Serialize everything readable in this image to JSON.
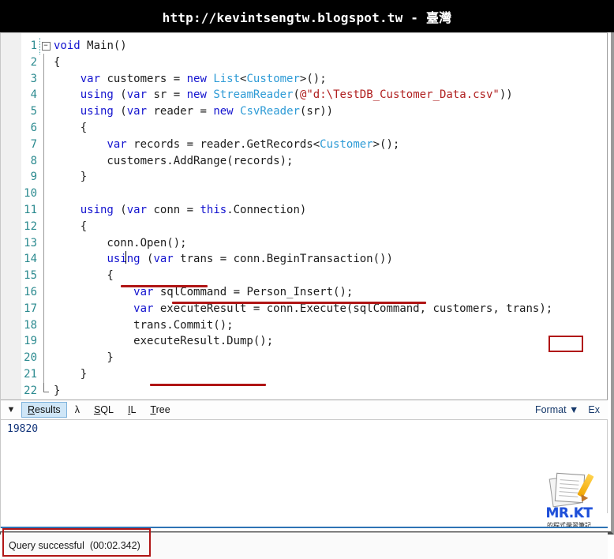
{
  "banner": {
    "title": "http://kevintsengtw.blogspot.tw - 臺灣"
  },
  "editor": {
    "lines": [
      {
        "no": "1",
        "segments": [
          {
            "t": "void ",
            "c": "kw"
          },
          {
            "t": "Main()",
            "c": "txt"
          }
        ]
      },
      {
        "no": "2",
        "segments": [
          {
            "t": "{",
            "c": "txt"
          }
        ]
      },
      {
        "no": "3",
        "segments": [
          {
            "t": "    ",
            "c": "txt"
          },
          {
            "t": "var",
            "c": "kw"
          },
          {
            "t": " customers = ",
            "c": "txt"
          },
          {
            "t": "new",
            "c": "kw"
          },
          {
            "t": " ",
            "c": "txt"
          },
          {
            "t": "List",
            "c": "typ"
          },
          {
            "t": "<",
            "c": "txt"
          },
          {
            "t": "Customer",
            "c": "typ"
          },
          {
            "t": ">();",
            "c": "txt"
          }
        ]
      },
      {
        "no": "4",
        "segments": [
          {
            "t": "    ",
            "c": "txt"
          },
          {
            "t": "using",
            "c": "kw"
          },
          {
            "t": " (",
            "c": "txt"
          },
          {
            "t": "var",
            "c": "kw"
          },
          {
            "t": " sr = ",
            "c": "txt"
          },
          {
            "t": "new",
            "c": "kw"
          },
          {
            "t": " ",
            "c": "txt"
          },
          {
            "t": "StreamReader",
            "c": "typ"
          },
          {
            "t": "(",
            "c": "txt"
          },
          {
            "t": "@\"d:\\TestDB_Customer_Data.csv\"",
            "c": "str"
          },
          {
            "t": "))",
            "c": "txt"
          }
        ]
      },
      {
        "no": "5",
        "segments": [
          {
            "t": "    ",
            "c": "txt"
          },
          {
            "t": "using",
            "c": "kw"
          },
          {
            "t": " (",
            "c": "txt"
          },
          {
            "t": "var",
            "c": "kw"
          },
          {
            "t": " reader = ",
            "c": "txt"
          },
          {
            "t": "new",
            "c": "kw"
          },
          {
            "t": " ",
            "c": "txt"
          },
          {
            "t": "CsvReader",
            "c": "typ"
          },
          {
            "t": "(sr))",
            "c": "txt"
          }
        ]
      },
      {
        "no": "6",
        "segments": [
          {
            "t": "    {",
            "c": "txt"
          }
        ]
      },
      {
        "no": "7",
        "segments": [
          {
            "t": "        ",
            "c": "txt"
          },
          {
            "t": "var",
            "c": "kw"
          },
          {
            "t": " records = reader.GetRecords<",
            "c": "txt"
          },
          {
            "t": "Customer",
            "c": "typ"
          },
          {
            "t": ">();",
            "c": "txt"
          }
        ]
      },
      {
        "no": "8",
        "segments": [
          {
            "t": "        customers.AddRange(records);",
            "c": "txt"
          }
        ]
      },
      {
        "no": "9",
        "segments": [
          {
            "t": "    }",
            "c": "txt"
          }
        ]
      },
      {
        "no": "10",
        "segments": [
          {
            "t": "",
            "c": "txt"
          }
        ]
      },
      {
        "no": "11",
        "segments": [
          {
            "t": "    ",
            "c": "txt"
          },
          {
            "t": "using",
            "c": "kw"
          },
          {
            "t": " (",
            "c": "txt"
          },
          {
            "t": "var",
            "c": "kw"
          },
          {
            "t": " conn = ",
            "c": "txt"
          },
          {
            "t": "this",
            "c": "kw"
          },
          {
            "t": ".Connection)",
            "c": "txt"
          }
        ]
      },
      {
        "no": "12",
        "segments": [
          {
            "t": "    {",
            "c": "txt"
          }
        ]
      },
      {
        "no": "13",
        "segments": [
          {
            "t": "        conn.Open();",
            "c": "txt"
          }
        ]
      },
      {
        "no": "14",
        "segments": [
          {
            "t": "        ",
            "c": "txt"
          },
          {
            "t": "using",
            "c": "kw"
          },
          {
            "t": " (",
            "c": "txt"
          },
          {
            "t": "var",
            "c": "kw"
          },
          {
            "t": " trans = conn.BeginTransaction())",
            "c": "txt"
          }
        ]
      },
      {
        "no": "15",
        "segments": [
          {
            "t": "        {",
            "c": "txt"
          }
        ]
      },
      {
        "no": "16",
        "segments": [
          {
            "t": "            ",
            "c": "txt"
          },
          {
            "t": "var",
            "c": "kw"
          },
          {
            "t": " sqlCommand = Person_Insert();",
            "c": "txt"
          }
        ]
      },
      {
        "no": "17",
        "segments": [
          {
            "t": "            ",
            "c": "txt"
          },
          {
            "t": "var",
            "c": "kw"
          },
          {
            "t": " executeResult = conn.Execute(sqlCommand, customers, trans);",
            "c": "txt"
          }
        ]
      },
      {
        "no": "18",
        "segments": [
          {
            "t": "            trans.Commit();",
            "c": "txt"
          }
        ]
      },
      {
        "no": "19",
        "segments": [
          {
            "t": "            executeResult.Dump();",
            "c": "txt"
          }
        ]
      },
      {
        "no": "20",
        "segments": [
          {
            "t": "        }",
            "c": "txt"
          }
        ]
      },
      {
        "no": "21",
        "segments": [
          {
            "t": "    }",
            "c": "txt"
          }
        ]
      },
      {
        "no": "22",
        "segments": [
          {
            "t": "}",
            "c": "txt"
          }
        ]
      }
    ],
    "annotations": {
      "underline_conn_open": "conn.Open();",
      "underline_begin_transaction": "var trans = conn.BeginTransaction())",
      "underline_trans_commit": "trans.Commit();",
      "highlight_box_trans": "trans"
    }
  },
  "results_toolbar": {
    "collapse_arrow": "chevron-down-icon",
    "tabs": [
      {
        "label": "Results",
        "accel": "R",
        "active": true
      },
      {
        "label": "λ",
        "accel": "",
        "active": false
      },
      {
        "label": "SQL",
        "accel": "S",
        "active": false
      },
      {
        "label": "IL",
        "accel": "I",
        "active": false
      },
      {
        "label": "Tree",
        "accel": "T",
        "active": false
      }
    ],
    "format_label": "Format",
    "format_caret": "▼",
    "export_label": "Ex"
  },
  "results": {
    "rows": [
      "19820"
    ]
  },
  "statusbar": {
    "message": "Query successful  (00:02.342)"
  },
  "logo": {
    "brand": "MR.KT",
    "subtitle": "的程式學習筆記"
  },
  "colors": {
    "keyword": "#1414cf",
    "type": "#2e9bd6",
    "string": "#b02020",
    "line_number": "#2b8a8f",
    "annotation_red": "#b01515",
    "tab_active_bg": "#cfe6f7",
    "banner_bg": "#000000",
    "bottom_accent": "#2e74b5"
  }
}
